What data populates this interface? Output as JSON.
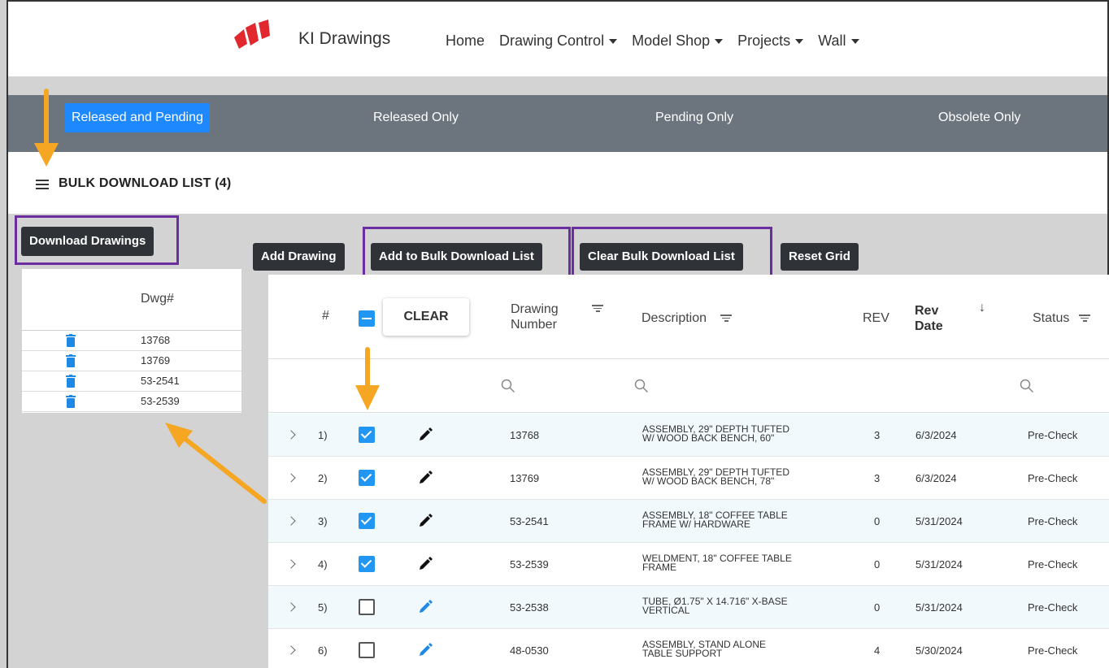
{
  "nav": {
    "brand": "KI Drawings",
    "links": [
      "Home",
      "Drawing Control",
      "Model Shop",
      "Projects",
      "Wall"
    ]
  },
  "status_filter": {
    "options": [
      "Released and Pending",
      "Released Only",
      "Pending Only",
      "Obsolete Only"
    ],
    "active": "Released and Pending"
  },
  "bulk": {
    "title": "BULK DOWNLOAD LIST (4)",
    "download_label": "Download Drawings",
    "column_header": "Dwg#",
    "items": [
      "13768",
      "13769",
      "53-2541",
      "53-2539"
    ]
  },
  "toolbar": {
    "add_drawing": "Add Drawing",
    "add_to_bulk": "Add to Bulk Download List",
    "clear_bulk": "Clear Bulk Download List",
    "reset_grid": "Reset Grid"
  },
  "grid": {
    "headers": {
      "index": "#",
      "clear": "CLEAR",
      "drawing_number": "Drawing Number",
      "description": "Description",
      "rev": "REV",
      "rev_date": "Rev Date",
      "status": "Status"
    },
    "rows": [
      {
        "idx": "1)",
        "checked": true,
        "num": "13768",
        "desc1": "ASSEMBLY, 29\" DEPTH TUFTED",
        "desc2": "W/ WOOD BACK BENCH, 60\"",
        "rev": "3",
        "date": "6/3/2024",
        "status": "Pre-Check"
      },
      {
        "idx": "2)",
        "checked": true,
        "num": "13769",
        "desc1": "ASSEMBLY, 29\" DEPTH TUFTED",
        "desc2": "W/ WOOD BACK BENCH, 78\"",
        "rev": "3",
        "date": "6/3/2024",
        "status": "Pre-Check"
      },
      {
        "idx": "3)",
        "checked": true,
        "num": "53-2541",
        "desc1": "ASSEMBLY, 18\" COFFEE TABLE",
        "desc2": "FRAME W/ HARDWARE",
        "rev": "0",
        "date": "5/31/2024",
        "status": "Pre-Check"
      },
      {
        "idx": "4)",
        "checked": true,
        "num": "53-2539",
        "desc1": "WELDMENT, 18\" COFFEE TABLE",
        "desc2": "FRAME",
        "rev": "0",
        "date": "5/31/2024",
        "status": "Pre-Check"
      },
      {
        "idx": "5)",
        "checked": false,
        "num": "53-2538",
        "desc1": "TUBE, Ø1.75\" X 14.716\" X-BASE",
        "desc2": "VERTICAL",
        "rev": "0",
        "date": "5/31/2024",
        "status": "Pre-Check"
      },
      {
        "idx": "6)",
        "checked": false,
        "num": "48-0530",
        "desc1": "ASSEMBLY, STAND ALONE",
        "desc2": "TABLE SUPPORT",
        "rev": "4",
        "date": "5/30/2024",
        "status": "Pre-Check"
      }
    ]
  },
  "colors": {
    "accent": "#2196f3",
    "active_tab": "#1e88ff",
    "status_bar": "#6c757d",
    "highlight_box": "#6a2ea0",
    "annotation_arrow": "#f5a623",
    "logo": "#e0282e"
  },
  "icons": [
    "menu-icon",
    "trash-icon",
    "caret-down-icon",
    "filter-icon",
    "search-icon",
    "pencil-icon",
    "chevron-right-icon",
    "sort-down-icon",
    "checkbox-icon"
  ]
}
